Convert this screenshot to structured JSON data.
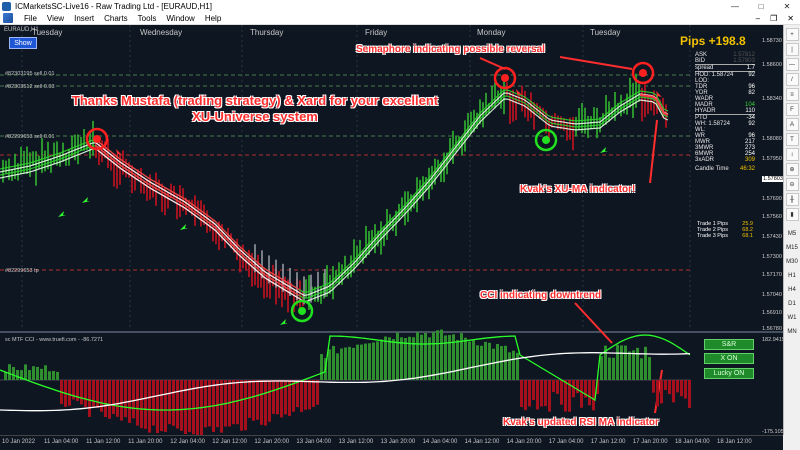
{
  "window": {
    "title": "ICMarketsSC-Live16 - Raw Trading Ltd - [EURAUD,H1]",
    "min": "—",
    "max": "□",
    "close": "✕"
  },
  "menu": {
    "items": [
      "File",
      "View",
      "Insert",
      "Charts",
      "Tools",
      "Window",
      "Help"
    ],
    "mdi_min": "–",
    "mdi_restore": "❐",
    "mdi_close": "✕"
  },
  "chart": {
    "symbol_label": "EURAUD,H1",
    "show_button": "Show",
    "days": [
      "Tuesday",
      "Wednesday",
      "Thursday",
      "Friday",
      "Monday",
      "Tuesday"
    ],
    "headline": "Thanks Mustafa (trading strategy) & Xard for your excellent XU-Universe system",
    "pips": "Pips +198.8",
    "annotations": {
      "semaphore": "Semaphore indicating possible reversal",
      "xu_ma": "Kvak's XU-MA indicator!",
      "cci": "CCI indicating downtrend",
      "rsi": "Kvak's updated RSI MA indicator"
    },
    "hlines": [
      "#82303195 sell 0.01",
      "#82303512 sell 0.03",
      "#82299653 sell 0.01",
      "#82299653 tp"
    ],
    "price_labels": [
      "1.58730",
      "1.58600",
      "1.58340",
      "1.58080",
      "1.57950",
      "1.57820",
      "1.57690",
      "1.57560",
      "1.57430",
      "1.57300",
      "1.57170",
      "1.57040",
      "1.56910",
      "1.56780"
    ],
    "current_price": "1.57803"
  },
  "panel": {
    "ask_label": "ASK",
    "ask_value": "1.57812",
    "bid_label": "BID",
    "bid_value": "1.57803",
    "spread_label": "spread",
    "spread_value": "1.7",
    "hod_label": "HOD: 1.58724",
    "hod_value": "92",
    "lod_label": "LOD:",
    "rows": [
      {
        "label": "TDR",
        "value": "96"
      },
      {
        "label": "YDR",
        "value": "82"
      },
      {
        "label": "WADR",
        "value": ""
      },
      {
        "label": "MADR",
        "value": "104"
      },
      {
        "label": "HYADR",
        "value": "110"
      }
    ],
    "pto_label": "PTO",
    "pto_value": "-34",
    "wh_label": "WH: 1.58724",
    "wh_value": "92",
    "wl_label": "WL:",
    "rows2": [
      {
        "label": "WR",
        "value": "96"
      },
      {
        "label": "MWR",
        "value": "217"
      },
      {
        "label": "3MWR",
        "value": "273"
      },
      {
        "label": "6MWR",
        "value": "254"
      },
      {
        "label": "3xADR",
        "value": "309"
      }
    ],
    "candle_time_label": "Candle Time",
    "candle_time_value": "46:32",
    "trades": [
      {
        "label": "Trade 1 Pips",
        "value": "25.9"
      },
      {
        "label": "Trade 2 Pips",
        "value": "68.2"
      },
      {
        "label": "Trade 3 Pips",
        "value": "68.1"
      }
    ]
  },
  "cci": {
    "title": "sc MTF CCI - www.truefi.com - -86.7271",
    "buttons": [
      "S&R",
      "X ON",
      "Lucky ON"
    ],
    "top_value": "182.9415",
    "bottom_value": "-175.1051"
  },
  "toolbar": {
    "timeframes": [
      "M5",
      "M15",
      "M30",
      "H1",
      "H4",
      "D1",
      "W1",
      "MN"
    ]
  },
  "time_axis": [
    "10 Jan 2022",
    "11 Jan 04:00",
    "11 Jan 12:00",
    "11 Jan 20:00",
    "12 Jan 04:00",
    "12 Jan 12:00",
    "12 Jan 20:00",
    "13 Jan 04:00",
    "13 Jan 12:00",
    "13 Jan 20:00",
    "14 Jan 04:00",
    "14 Jan 12:00",
    "14 Jan 20:00",
    "17 Jan 04:00",
    "17 Jan 12:00",
    "17 Jan 20:00",
    "18 Jan 04:00",
    "18 Jan 12:00"
  ],
  "colors": {
    "background": "#0e1621",
    "bull": "#2fa32f",
    "bear": "#b3121f",
    "ma_band": "#2fd12f",
    "annotation": "#ff2d2d",
    "pips": "#f2c200"
  }
}
